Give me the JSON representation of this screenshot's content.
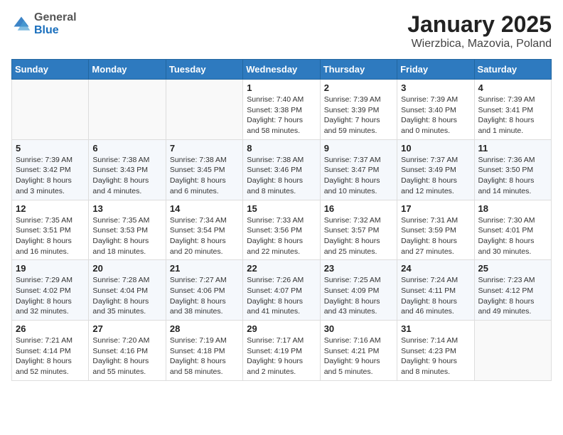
{
  "logo": {
    "line1": "General",
    "line2": "Blue"
  },
  "title": "January 2025",
  "subtitle": "Wierzbica, Mazovia, Poland",
  "weekdays": [
    "Sunday",
    "Monday",
    "Tuesday",
    "Wednesday",
    "Thursday",
    "Friday",
    "Saturday"
  ],
  "weeks": [
    [
      {
        "day": "",
        "detail": ""
      },
      {
        "day": "",
        "detail": ""
      },
      {
        "day": "",
        "detail": ""
      },
      {
        "day": "1",
        "detail": "Sunrise: 7:40 AM\nSunset: 3:38 PM\nDaylight: 7 hours\nand 58 minutes."
      },
      {
        "day": "2",
        "detail": "Sunrise: 7:39 AM\nSunset: 3:39 PM\nDaylight: 7 hours\nand 59 minutes."
      },
      {
        "day": "3",
        "detail": "Sunrise: 7:39 AM\nSunset: 3:40 PM\nDaylight: 8 hours\nand 0 minutes."
      },
      {
        "day": "4",
        "detail": "Sunrise: 7:39 AM\nSunset: 3:41 PM\nDaylight: 8 hours\nand 1 minute."
      }
    ],
    [
      {
        "day": "5",
        "detail": "Sunrise: 7:39 AM\nSunset: 3:42 PM\nDaylight: 8 hours\nand 3 minutes."
      },
      {
        "day": "6",
        "detail": "Sunrise: 7:38 AM\nSunset: 3:43 PM\nDaylight: 8 hours\nand 4 minutes."
      },
      {
        "day": "7",
        "detail": "Sunrise: 7:38 AM\nSunset: 3:45 PM\nDaylight: 8 hours\nand 6 minutes."
      },
      {
        "day": "8",
        "detail": "Sunrise: 7:38 AM\nSunset: 3:46 PM\nDaylight: 8 hours\nand 8 minutes."
      },
      {
        "day": "9",
        "detail": "Sunrise: 7:37 AM\nSunset: 3:47 PM\nDaylight: 8 hours\nand 10 minutes."
      },
      {
        "day": "10",
        "detail": "Sunrise: 7:37 AM\nSunset: 3:49 PM\nDaylight: 8 hours\nand 12 minutes."
      },
      {
        "day": "11",
        "detail": "Sunrise: 7:36 AM\nSunset: 3:50 PM\nDaylight: 8 hours\nand 14 minutes."
      }
    ],
    [
      {
        "day": "12",
        "detail": "Sunrise: 7:35 AM\nSunset: 3:51 PM\nDaylight: 8 hours\nand 16 minutes."
      },
      {
        "day": "13",
        "detail": "Sunrise: 7:35 AM\nSunset: 3:53 PM\nDaylight: 8 hours\nand 18 minutes."
      },
      {
        "day": "14",
        "detail": "Sunrise: 7:34 AM\nSunset: 3:54 PM\nDaylight: 8 hours\nand 20 minutes."
      },
      {
        "day": "15",
        "detail": "Sunrise: 7:33 AM\nSunset: 3:56 PM\nDaylight: 8 hours\nand 22 minutes."
      },
      {
        "day": "16",
        "detail": "Sunrise: 7:32 AM\nSunset: 3:57 PM\nDaylight: 8 hours\nand 25 minutes."
      },
      {
        "day": "17",
        "detail": "Sunrise: 7:31 AM\nSunset: 3:59 PM\nDaylight: 8 hours\nand 27 minutes."
      },
      {
        "day": "18",
        "detail": "Sunrise: 7:30 AM\nSunset: 4:01 PM\nDaylight: 8 hours\nand 30 minutes."
      }
    ],
    [
      {
        "day": "19",
        "detail": "Sunrise: 7:29 AM\nSunset: 4:02 PM\nDaylight: 8 hours\nand 32 minutes."
      },
      {
        "day": "20",
        "detail": "Sunrise: 7:28 AM\nSunset: 4:04 PM\nDaylight: 8 hours\nand 35 minutes."
      },
      {
        "day": "21",
        "detail": "Sunrise: 7:27 AM\nSunset: 4:06 PM\nDaylight: 8 hours\nand 38 minutes."
      },
      {
        "day": "22",
        "detail": "Sunrise: 7:26 AM\nSunset: 4:07 PM\nDaylight: 8 hours\nand 41 minutes."
      },
      {
        "day": "23",
        "detail": "Sunrise: 7:25 AM\nSunset: 4:09 PM\nDaylight: 8 hours\nand 43 minutes."
      },
      {
        "day": "24",
        "detail": "Sunrise: 7:24 AM\nSunset: 4:11 PM\nDaylight: 8 hours\nand 46 minutes."
      },
      {
        "day": "25",
        "detail": "Sunrise: 7:23 AM\nSunset: 4:12 PM\nDaylight: 8 hours\nand 49 minutes."
      }
    ],
    [
      {
        "day": "26",
        "detail": "Sunrise: 7:21 AM\nSunset: 4:14 PM\nDaylight: 8 hours\nand 52 minutes."
      },
      {
        "day": "27",
        "detail": "Sunrise: 7:20 AM\nSunset: 4:16 PM\nDaylight: 8 hours\nand 55 minutes."
      },
      {
        "day": "28",
        "detail": "Sunrise: 7:19 AM\nSunset: 4:18 PM\nDaylight: 8 hours\nand 58 minutes."
      },
      {
        "day": "29",
        "detail": "Sunrise: 7:17 AM\nSunset: 4:19 PM\nDaylight: 9 hours\nand 2 minutes."
      },
      {
        "day": "30",
        "detail": "Sunrise: 7:16 AM\nSunset: 4:21 PM\nDaylight: 9 hours\nand 5 minutes."
      },
      {
        "day": "31",
        "detail": "Sunrise: 7:14 AM\nSunset: 4:23 PM\nDaylight: 9 hours\nand 8 minutes."
      },
      {
        "day": "",
        "detail": ""
      }
    ]
  ]
}
